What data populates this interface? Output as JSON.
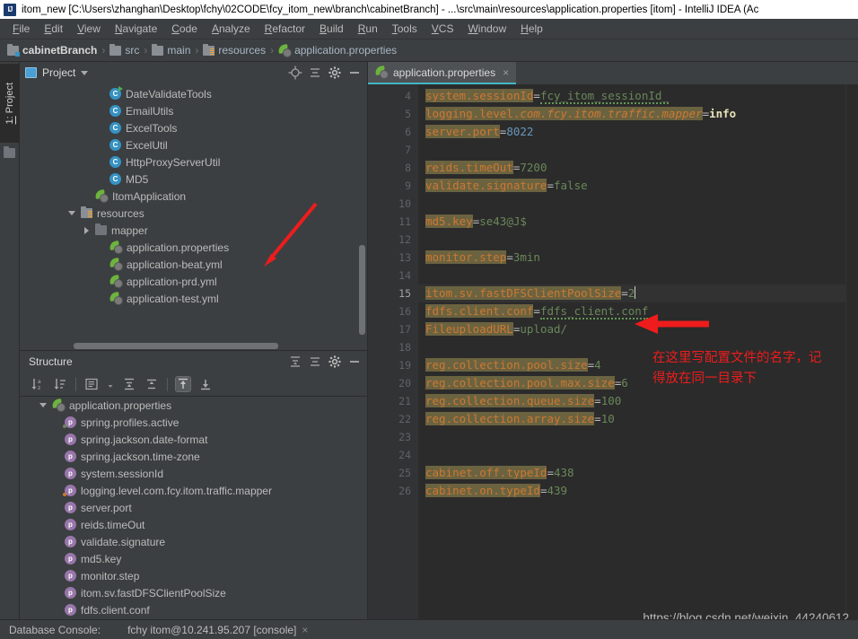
{
  "window": {
    "title": "itom_new [C:\\Users\\zhanghan\\Desktop\\fchy\\02CODE\\fcy_itom_new\\branch\\cabinetBranch] - ...\\src\\main\\resources\\application.properties [itom] - IntelliJ IDEA (Ac",
    "logo": "IJ"
  },
  "menubar": {
    "items": [
      {
        "label": "File"
      },
      {
        "label": "Edit"
      },
      {
        "label": "View"
      },
      {
        "label": "Navigate"
      },
      {
        "label": "Code"
      },
      {
        "label": "Analyze"
      },
      {
        "label": "Refactor"
      },
      {
        "label": "Build"
      },
      {
        "label": "Run"
      },
      {
        "label": "Tools"
      },
      {
        "label": "VCS"
      },
      {
        "label": "Window"
      },
      {
        "label": "Help"
      }
    ]
  },
  "breadcrumb": {
    "items": [
      {
        "label": "cabinetBranch",
        "icon": "module-folder-icon"
      },
      {
        "label": "src",
        "icon": "folder-icon"
      },
      {
        "label": "main",
        "icon": "folder-icon"
      },
      {
        "label": "resources",
        "icon": "resources-folder-icon"
      },
      {
        "label": "application.properties",
        "icon": "spring-properties-icon"
      }
    ],
    "separator": "›"
  },
  "left_strip": {
    "tab_number": "1:",
    "tab_label": " Project",
    "folder_icon": "folder-icon"
  },
  "project_tool_window": {
    "title": "Project",
    "dropdown_icon": "chevron-down-icon",
    "buttons": [
      "locate-icon",
      "collapse-all-icon",
      "settings-gear-icon",
      "hide-icon"
    ],
    "tree": [
      {
        "label": "DateValidateTools",
        "indent": 5,
        "icon": "class-runnable-icon",
        "arrow": "none"
      },
      {
        "label": "EmailUtils",
        "indent": 5,
        "icon": "class-icon",
        "arrow": "none"
      },
      {
        "label": "ExcelTools",
        "indent": 5,
        "icon": "class-icon",
        "arrow": "none"
      },
      {
        "label": "ExcelUtil",
        "indent": 5,
        "icon": "class-icon",
        "arrow": "none"
      },
      {
        "label": "HttpProxyServerUtil",
        "indent": 5,
        "icon": "class-icon",
        "arrow": "none"
      },
      {
        "label": "MD5",
        "indent": 5,
        "icon": "class-icon",
        "arrow": "none"
      },
      {
        "label": "ItomApplication",
        "indent": 4,
        "icon": "spring-class-icon",
        "arrow": "none"
      },
      {
        "label": "resources",
        "indent": 3,
        "icon": "resources-folder-icon",
        "arrow": "down"
      },
      {
        "label": "mapper",
        "indent": 4,
        "icon": "folder-dark-icon",
        "arrow": "right"
      },
      {
        "label": "application.properties",
        "indent": 5,
        "icon": "spring-properties-icon",
        "arrow": "none"
      },
      {
        "label": "application-beat.yml",
        "indent": 5,
        "icon": "spring-properties-icon",
        "arrow": "none"
      },
      {
        "label": "application-prd.yml",
        "indent": 5,
        "icon": "spring-properties-icon",
        "arrow": "none"
      },
      {
        "label": "application-test.yml",
        "indent": 5,
        "icon": "spring-properties-icon",
        "arrow": "none"
      }
    ]
  },
  "structure_tool_window": {
    "title": "Structure",
    "header_buttons": [
      "expand-all-icon",
      "collapse-all-icon",
      "settings-gear-icon",
      "hide-icon"
    ],
    "toolbar_buttons": [
      "sort-alphabetically-icon",
      "sort-by-type-icon",
      "group-icon",
      "expand-all-icon",
      "collapse-all-icon",
      "autoscroll-to-source-icon",
      "autoscroll-from-source-icon"
    ],
    "tree": [
      {
        "label": "application.properties",
        "indent": 1,
        "icon": "spring-properties-icon",
        "arrow": "down"
      },
      {
        "label": "spring.profiles.active",
        "indent": 2,
        "icon": "property-icon-green-dot",
        "arrow": "none"
      },
      {
        "label": "spring.jackson.date-format",
        "indent": 2,
        "icon": "property-icon",
        "arrow": "none"
      },
      {
        "label": "spring.jackson.time-zone",
        "indent": 2,
        "icon": "property-icon",
        "arrow": "none"
      },
      {
        "label": "system.sessionId",
        "indent": 2,
        "icon": "property-icon",
        "arrow": "none"
      },
      {
        "label": "logging.level.com.fcy.itom.traffic.mapper",
        "indent": 2,
        "icon": "property-icon-orange-dot",
        "arrow": "none"
      },
      {
        "label": "server.port",
        "indent": 2,
        "icon": "property-icon",
        "arrow": "none"
      },
      {
        "label": "reids.timeOut",
        "indent": 2,
        "icon": "property-icon",
        "arrow": "none"
      },
      {
        "label": "validate.signature",
        "indent": 2,
        "icon": "property-icon",
        "arrow": "none"
      },
      {
        "label": "md5.key",
        "indent": 2,
        "icon": "property-icon",
        "arrow": "none"
      },
      {
        "label": "monitor.step",
        "indent": 2,
        "icon": "property-icon",
        "arrow": "none"
      },
      {
        "label": "itom.sv.fastDFSClientPoolSize",
        "indent": 2,
        "icon": "property-icon",
        "arrow": "none"
      },
      {
        "label": "fdfs.client.conf",
        "indent": 2,
        "icon": "property-icon",
        "arrow": "none"
      }
    ]
  },
  "editor": {
    "tab": {
      "label": "application.properties",
      "icon": "spring-properties-icon",
      "close_label": "×",
      "accent_color": "#42b6c4"
    },
    "current_line": 15,
    "lines": [
      {
        "num": "4",
        "key": "system.sessionId",
        "sep": "=",
        "value": "fcy_itom_sessionId_",
        "value_class": "v wavy"
      },
      {
        "num": "5",
        "key": "",
        "raw_html": "logging.level.<i class=\"it\">com.fcy.itom.traffic.mapper</i>=<b class=\"kw\">info</b>"
      },
      {
        "num": "6",
        "key": "server.port",
        "sep": "=",
        "value": "8022",
        "value_class": "num",
        "nokeybg": true
      },
      {
        "num": "7",
        "key": "",
        "value": ""
      },
      {
        "num": "8",
        "key": "reids.timeOut",
        "sep": "=",
        "value": "7200",
        "value_class": "v"
      },
      {
        "num": "9",
        "key": "validate.signature",
        "sep": "=",
        "value": "false",
        "value_class": "v"
      },
      {
        "num": "10",
        "key": "",
        "value": ""
      },
      {
        "num": "11",
        "key": "md5.key",
        "sep": "=",
        "value": "se43@J$",
        "value_class": "v"
      },
      {
        "num": "12",
        "key": "",
        "value": ""
      },
      {
        "num": "13",
        "key": "monitor.step",
        "sep": "=",
        "value": "3min",
        "value_class": "v"
      },
      {
        "num": "14",
        "key": "",
        "value": ""
      },
      {
        "num": "15",
        "key": "itom.sv.fastDFSClientPoolSize",
        "sep": "=",
        "value": "2",
        "value_class": "v",
        "caret": true
      },
      {
        "num": "16",
        "key": "fdfs.client.conf",
        "sep": "=",
        "value": "fdfs_client.conf",
        "value_class": "v wavy"
      },
      {
        "num": "17",
        "key": "FileuploadURL",
        "sep": "=",
        "value": "upload/",
        "value_class": "v"
      },
      {
        "num": "18",
        "key": "",
        "value": ""
      },
      {
        "num": "19",
        "key": "reg.collection.pool.size",
        "sep": "=",
        "value": "4",
        "value_class": "v"
      },
      {
        "num": "20",
        "key": "reg.collection.pool.max.size",
        "sep": "=",
        "value": "6",
        "value_class": "v"
      },
      {
        "num": "21",
        "key": "reg.collection.queue.size",
        "sep": "=",
        "value": "100",
        "value_class": "v"
      },
      {
        "num": "22",
        "key": "reg.collection.array.size",
        "sep": "=",
        "value": "10",
        "value_class": "v"
      },
      {
        "num": "23",
        "key": "",
        "value": ""
      },
      {
        "num": "24",
        "key": "",
        "value": ""
      },
      {
        "num": "25",
        "key": "cabinet.off.typeId",
        "sep": "=",
        "value": "438",
        "value_class": "v"
      },
      {
        "num": "26",
        "key": "cabinet.on.typeId",
        "sep": "=",
        "value": "439",
        "value_class": "v"
      }
    ]
  },
  "annotations": {
    "color": "#ee1c1c",
    "note_line1": "在这里写配置文件的名字，记",
    "note_line2": "得放在同一目录下"
  },
  "watermark": {
    "text": "https://blog.csdn.net/weixin_44240612"
  },
  "statusbar": {
    "label": "Database Console:",
    "session": "fchy itom@10.241.95.207 [console]",
    "close_label": "×"
  }
}
